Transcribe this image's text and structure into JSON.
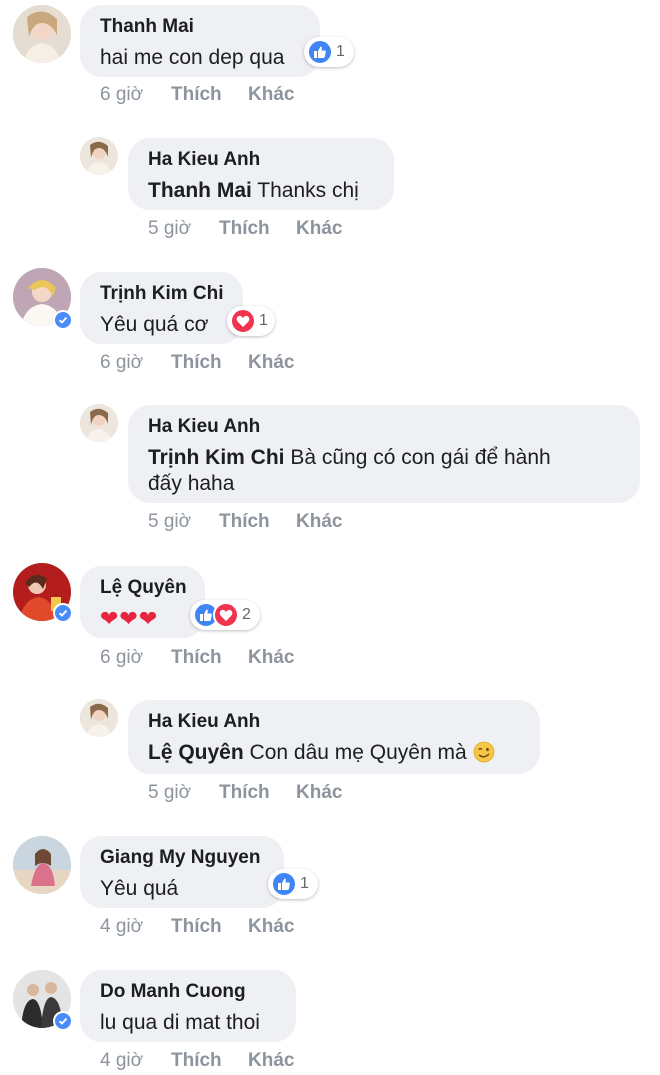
{
  "colors": {
    "like": "#3f85f6",
    "love": "#f0344f",
    "bubble": "#eff0f4",
    "meta": "#8d949e",
    "verified": "#4a8cf7"
  },
  "comments": [
    {
      "author": "Thanh Mai",
      "text": "hai me con dep qua",
      "time": "6 giờ",
      "like": "Thích",
      "more": "Khác",
      "reaction_count": "1",
      "reactions": [
        "like-icon"
      ]
    },
    {
      "author": "Ha Kieu Anh",
      "mention": "Thanh Mai",
      "text": " Thanks chị",
      "time": "5 giờ",
      "like": "Thích",
      "more": "Khác"
    },
    {
      "author": "Trịnh Kim Chi",
      "text": "Yêu quá cơ",
      "time": "6 giờ",
      "like": "Thích",
      "more": "Khác",
      "reaction_count": "1",
      "reactions": [
        "love-icon"
      ]
    },
    {
      "author": "Ha Kieu Anh",
      "mention": "Trịnh Kim Chi",
      "text": " Bà cũng có con gái để hành",
      "text2": "đấy haha",
      "time": "5 giờ",
      "like": "Thích",
      "more": "Khác"
    },
    {
      "author": "Lệ Quyên",
      "text": "❤❤❤",
      "time": "6 giờ",
      "like": "Thích",
      "more": "Khác",
      "reaction_count": "2",
      "reactions": [
        "like-icon",
        "love-icon"
      ]
    },
    {
      "author": "Ha Kieu Anh",
      "mention": "Lệ Quyên",
      "text": " Con dâu mẹ Quyên mà ",
      "emoji": "wink-emoji",
      "time": "5 giờ",
      "like": "Thích",
      "more": "Khác"
    },
    {
      "author": "Giang My Nguyen",
      "text": "Yêu quá",
      "time": "4 giờ",
      "like": "Thích",
      "more": "Khác",
      "reaction_count": "1",
      "reactions": [
        "like-icon"
      ]
    },
    {
      "author": "Do Manh Cuong",
      "text": "lu qua di mat thoi",
      "time": "4 giờ",
      "like": "Thích",
      "more": "Khác"
    }
  ]
}
